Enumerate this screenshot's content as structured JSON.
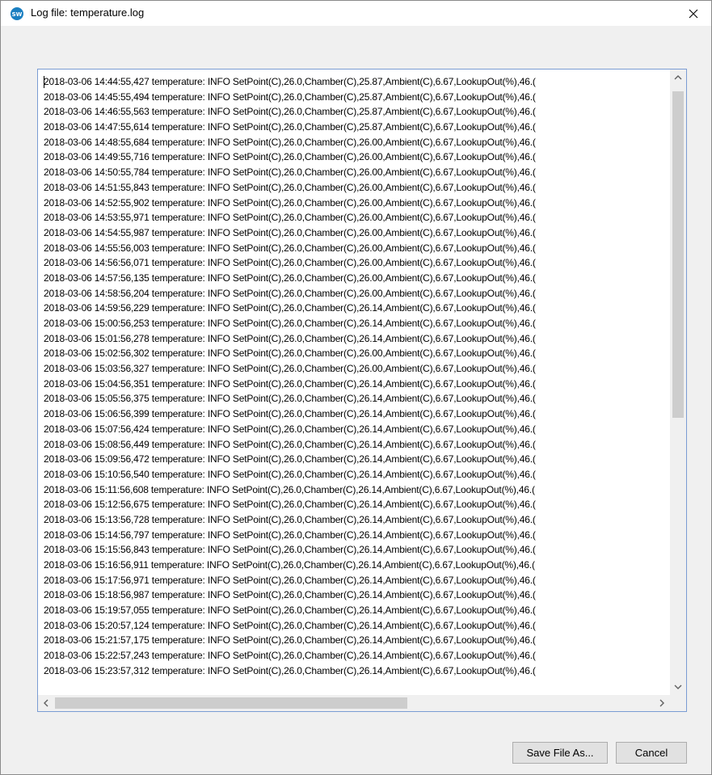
{
  "window": {
    "title": "Log file: temperature.log",
    "icon": "sw-app-icon"
  },
  "log": {
    "lines": [
      "2018-03-06 14:44:55,427 temperature: INFO SetPoint(C),26.0,Chamber(C),25.87,Ambient(C),6.67,LookupOut(%),46.(",
      "2018-03-06 14:45:55,494 temperature: INFO SetPoint(C),26.0,Chamber(C),25.87,Ambient(C),6.67,LookupOut(%),46.(",
      "2018-03-06 14:46:55,563 temperature: INFO SetPoint(C),26.0,Chamber(C),25.87,Ambient(C),6.67,LookupOut(%),46.(",
      "2018-03-06 14:47:55,614 temperature: INFO SetPoint(C),26.0,Chamber(C),25.87,Ambient(C),6.67,LookupOut(%),46.(",
      "2018-03-06 14:48:55,684 temperature: INFO SetPoint(C),26.0,Chamber(C),26.00,Ambient(C),6.67,LookupOut(%),46.(",
      "2018-03-06 14:49:55,716 temperature: INFO SetPoint(C),26.0,Chamber(C),26.00,Ambient(C),6.67,LookupOut(%),46.(",
      "2018-03-06 14:50:55,784 temperature: INFO SetPoint(C),26.0,Chamber(C),26.00,Ambient(C),6.67,LookupOut(%),46.(",
      "2018-03-06 14:51:55,843 temperature: INFO SetPoint(C),26.0,Chamber(C),26.00,Ambient(C),6.67,LookupOut(%),46.(",
      "2018-03-06 14:52:55,902 temperature: INFO SetPoint(C),26.0,Chamber(C),26.00,Ambient(C),6.67,LookupOut(%),46.(",
      "2018-03-06 14:53:55,971 temperature: INFO SetPoint(C),26.0,Chamber(C),26.00,Ambient(C),6.67,LookupOut(%),46.(",
      "2018-03-06 14:54:55,987 temperature: INFO SetPoint(C),26.0,Chamber(C),26.00,Ambient(C),6.67,LookupOut(%),46.(",
      "2018-03-06 14:55:56,003 temperature: INFO SetPoint(C),26.0,Chamber(C),26.00,Ambient(C),6.67,LookupOut(%),46.(",
      "2018-03-06 14:56:56,071 temperature: INFO SetPoint(C),26.0,Chamber(C),26.00,Ambient(C),6.67,LookupOut(%),46.(",
      "2018-03-06 14:57:56,135 temperature: INFO SetPoint(C),26.0,Chamber(C),26.00,Ambient(C),6.67,LookupOut(%),46.(",
      "2018-03-06 14:58:56,204 temperature: INFO SetPoint(C),26.0,Chamber(C),26.00,Ambient(C),6.67,LookupOut(%),46.(",
      "2018-03-06 14:59:56,229 temperature: INFO SetPoint(C),26.0,Chamber(C),26.14,Ambient(C),6.67,LookupOut(%),46.(",
      "2018-03-06 15:00:56,253 temperature: INFO SetPoint(C),26.0,Chamber(C),26.14,Ambient(C),6.67,LookupOut(%),46.(",
      "2018-03-06 15:01:56,278 temperature: INFO SetPoint(C),26.0,Chamber(C),26.14,Ambient(C),6.67,LookupOut(%),46.(",
      "2018-03-06 15:02:56,302 temperature: INFO SetPoint(C),26.0,Chamber(C),26.00,Ambient(C),6.67,LookupOut(%),46.(",
      "2018-03-06 15:03:56,327 temperature: INFO SetPoint(C),26.0,Chamber(C),26.00,Ambient(C),6.67,LookupOut(%),46.(",
      "2018-03-06 15:04:56,351 temperature: INFO SetPoint(C),26.0,Chamber(C),26.14,Ambient(C),6.67,LookupOut(%),46.(",
      "2018-03-06 15:05:56,375 temperature: INFO SetPoint(C),26.0,Chamber(C),26.14,Ambient(C),6.67,LookupOut(%),46.(",
      "2018-03-06 15:06:56,399 temperature: INFO SetPoint(C),26.0,Chamber(C),26.14,Ambient(C),6.67,LookupOut(%),46.(",
      "2018-03-06 15:07:56,424 temperature: INFO SetPoint(C),26.0,Chamber(C),26.14,Ambient(C),6.67,LookupOut(%),46.(",
      "2018-03-06 15:08:56,449 temperature: INFO SetPoint(C),26.0,Chamber(C),26.14,Ambient(C),6.67,LookupOut(%),46.(",
      "2018-03-06 15:09:56,472 temperature: INFO SetPoint(C),26.0,Chamber(C),26.14,Ambient(C),6.67,LookupOut(%),46.(",
      "2018-03-06 15:10:56,540 temperature: INFO SetPoint(C),26.0,Chamber(C),26.14,Ambient(C),6.67,LookupOut(%),46.(",
      "2018-03-06 15:11:56,608 temperature: INFO SetPoint(C),26.0,Chamber(C),26.14,Ambient(C),6.67,LookupOut(%),46.(",
      "2018-03-06 15:12:56,675 temperature: INFO SetPoint(C),26.0,Chamber(C),26.14,Ambient(C),6.67,LookupOut(%),46.(",
      "2018-03-06 15:13:56,728 temperature: INFO SetPoint(C),26.0,Chamber(C),26.14,Ambient(C),6.67,LookupOut(%),46.(",
      "2018-03-06 15:14:56,797 temperature: INFO SetPoint(C),26.0,Chamber(C),26.14,Ambient(C),6.67,LookupOut(%),46.(",
      "2018-03-06 15:15:56,843 temperature: INFO SetPoint(C),26.0,Chamber(C),26.14,Ambient(C),6.67,LookupOut(%),46.(",
      "2018-03-06 15:16:56,911 temperature: INFO SetPoint(C),26.0,Chamber(C),26.14,Ambient(C),6.67,LookupOut(%),46.(",
      "2018-03-06 15:17:56,971 temperature: INFO SetPoint(C),26.0,Chamber(C),26.14,Ambient(C),6.67,LookupOut(%),46.(",
      "2018-03-06 15:18:56,987 temperature: INFO SetPoint(C),26.0,Chamber(C),26.14,Ambient(C),6.67,LookupOut(%),46.(",
      "2018-03-06 15:19:57,055 temperature: INFO SetPoint(C),26.0,Chamber(C),26.14,Ambient(C),6.67,LookupOut(%),46.(",
      "2018-03-06 15:20:57,124 temperature: INFO SetPoint(C),26.0,Chamber(C),26.14,Ambient(C),6.67,LookupOut(%),46.(",
      "2018-03-06 15:21:57,175 temperature: INFO SetPoint(C),26.0,Chamber(C),26.14,Ambient(C),6.67,LookupOut(%),46.(",
      "2018-03-06 15:22:57,243 temperature: INFO SetPoint(C),26.0,Chamber(C),26.14,Ambient(C),6.67,LookupOut(%),46.(",
      "2018-03-06 15:23:57,312 temperature: INFO SetPoint(C),26.0,Chamber(C),26.14,Ambient(C),6.67,LookupOut(%),46.("
    ]
  },
  "buttons": {
    "save_label": "Save File As...",
    "cancel_label": "Cancel"
  },
  "colors": {
    "accent_border": "#7a9cd3",
    "scroll_thumb": "#cdcdcd",
    "window_bg": "#f0f0f0"
  }
}
